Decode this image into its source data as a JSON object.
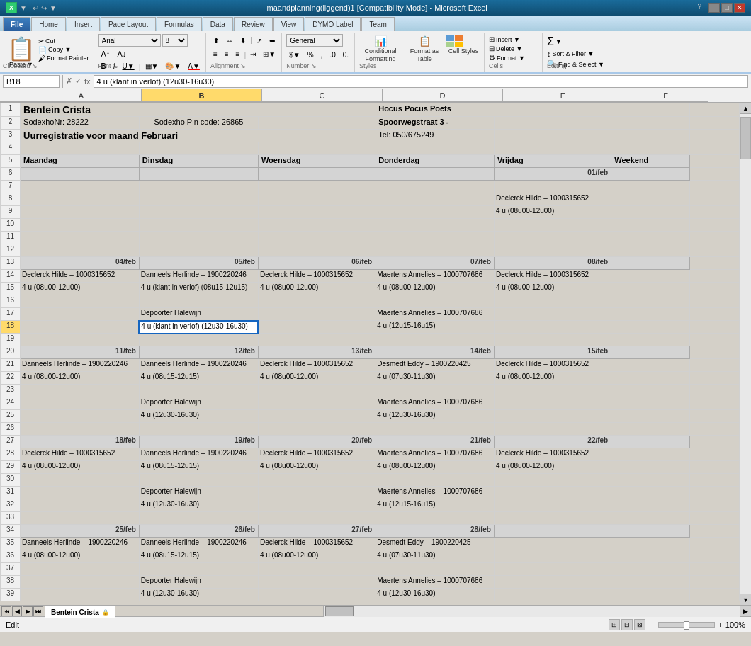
{
  "titleBar": {
    "title": "maandplanning(liggend)1 [Compatibility Mode] - Microsoft Excel",
    "icon": "X",
    "buttons": [
      "─",
      "□",
      "✕"
    ]
  },
  "tabs": [
    {
      "label": "File",
      "type": "file"
    },
    {
      "label": "Home",
      "sub": "H"
    },
    {
      "label": "Insert",
      "sub": "N"
    },
    {
      "label": "Page Layout",
      "sub": "P"
    },
    {
      "label": "Formulas",
      "sub": "M"
    },
    {
      "label": "Data",
      "sub": "A"
    },
    {
      "label": "Review",
      "sub": "R"
    },
    {
      "label": "View",
      "sub": "W"
    },
    {
      "label": "DYMO Label",
      "sub": "Y1"
    },
    {
      "label": "Team",
      "sub": "Y2"
    }
  ],
  "ribbon": {
    "font": "Arial",
    "size": "8",
    "groups": {
      "clipboard": "Clipboard",
      "font": "Font",
      "alignment": "Alignment",
      "number": "Number",
      "styles": "Styles",
      "cells": "Cells",
      "editing": "Editing"
    },
    "conditionalFormatting": "Conditional Formatting",
    "formatAsTable": "Format as Table",
    "cellStyles": "Cell Styles",
    "format": "Format ▼"
  },
  "formulaBar": {
    "nameBox": "B18",
    "formula": "4 u (klant in verlof) (12u30-16u30)"
  },
  "columns": [
    "A",
    "B",
    "C",
    "D",
    "E",
    "F"
  ],
  "spreadsheet": {
    "title1": "Bentein Crista",
    "title2_left": "SodexhoNr: 28222",
    "title2_middle": "Sodexho Pin code: 26865",
    "title2_right": "Hocus Pocus Poets",
    "title3": "Uurregistratie voor maand Februari",
    "title2_addr": "Spoorwegstraat 3 -",
    "title2_tel": "Tel: 050/675249",
    "days": [
      "Maandag",
      "Dinsdag",
      "Woensdag",
      "Donderdag",
      "Vrijdag",
      "Weekend"
    ],
    "weeks": [
      {
        "row": 6,
        "dates": [
          "",
          "",
          "",
          "",
          "01/feb",
          ""
        ],
        "rows": [
          {
            "row": 7,
            "cells": [
              "",
              "",
              "",
              "",
              "",
              ""
            ]
          },
          {
            "row": 8,
            "cells": [
              "",
              "",
              "",
              "",
              "Declerck Hilde – 1000315652",
              ""
            ]
          },
          {
            "row": 9,
            "cells": [
              "",
              "",
              "",
              "",
              "4 u (08u00-12u00)",
              ""
            ]
          },
          {
            "row": 10,
            "cells": [
              "",
              "",
              "",
              "",
              "",
              ""
            ]
          },
          {
            "row": 11,
            "cells": [
              "",
              "",
              "",
              "",
              "",
              ""
            ]
          },
          {
            "row": 12,
            "cells": [
              "",
              "",
              "",
              "",
              "",
              ""
            ]
          }
        ]
      },
      {
        "row": 13,
        "dates": [
          "04/feb",
          "05/feb",
          "06/feb",
          "07/feb",
          "08/feb",
          ""
        ],
        "rows": [
          {
            "row": 14,
            "cells": [
              "Declerck Hilde – 1000315652",
              "Danneels Herlinde – 1900220246",
              "Declerck Hilde – 1000315652",
              "Maertens Annelies – 1000707686",
              "Declerck Hilde – 1000315652",
              ""
            ]
          },
          {
            "row": 15,
            "cells": [
              "4 u (08u00-12u00)",
              "4 u (klant in verlof) (08u15-12u15)",
              "4 u (08u00-12u00)",
              "4 u (08u00-12u00)",
              "4 u (08u00-12u00)",
              ""
            ]
          },
          {
            "row": 16,
            "cells": [
              "",
              "",
              "",
              "",
              "",
              ""
            ]
          },
          {
            "row": 17,
            "cells": [
              "",
              "Depoorter Halewijn",
              "",
              "Maertens Annelies – 1000707686",
              "",
              ""
            ]
          },
          {
            "row": 18,
            "cells": [
              "",
              "4 u (klant in verlof) (12u30-16u30)",
              "",
              "4 u (12u15-16u15)",
              "",
              ""
            ]
          },
          {
            "row": 19,
            "cells": [
              "",
              "",
              "",
              "",
              "",
              ""
            ]
          }
        ]
      },
      {
        "row": 20,
        "dates": [
          "11/feb",
          "12/feb",
          "13/feb",
          "14/feb",
          "15/feb",
          ""
        ],
        "rows": [
          {
            "row": 21,
            "cells": [
              "Danneels Herlinde – 1900220246",
              "Danneels Herlinde – 1900220246",
              "Declerck Hilde – 1000315652",
              "Desmedt Eddy – 1900220425",
              "Declerck Hilde – 1000315652",
              ""
            ]
          },
          {
            "row": 22,
            "cells": [
              "4 u (08u00-12u00)",
              "4 u (08u15-12u15)",
              "4 u (08u00-12u00)",
              "4 u (07u30-11u30)",
              "4 u (08u00-12u00)",
              ""
            ]
          },
          {
            "row": 23,
            "cells": [
              "",
              "",
              "",
              "",
              "",
              ""
            ]
          },
          {
            "row": 24,
            "cells": [
              "",
              "Depoorter Halewijn",
              "",
              "Maertens Annelies – 1000707686",
              "",
              ""
            ]
          },
          {
            "row": 25,
            "cells": [
              "",
              "4 u (12u30-16u30)",
              "",
              "4 u (12u30-16u30)",
              "",
              ""
            ]
          },
          {
            "row": 26,
            "cells": [
              "",
              "",
              "",
              "",
              "",
              ""
            ]
          }
        ]
      },
      {
        "row": 27,
        "dates": [
          "18/feb",
          "19/feb",
          "20/feb",
          "21/feb",
          "22/feb",
          ""
        ],
        "rows": [
          {
            "row": 28,
            "cells": [
              "Declerck Hilde – 1000315652",
              "Danneels Herlinde – 1900220246",
              "Declerck Hilde – 1000315652",
              "Maertens Annelies – 1000707686",
              "Declerck Hilde – 1000315652",
              ""
            ]
          },
          {
            "row": 29,
            "cells": [
              "4 u (08u00-12u00)",
              "4 u (08u15-12u15)",
              "4 u (08u00-12u00)",
              "4 u (08u00-12u00)",
              "4 u (08u00-12u00)",
              ""
            ]
          },
          {
            "row": 30,
            "cells": [
              "",
              "",
              "",
              "",
              "",
              ""
            ]
          },
          {
            "row": 31,
            "cells": [
              "",
              "Depoorter Halewijn",
              "",
              "Maertens Annelies – 1000707686",
              "",
              ""
            ]
          },
          {
            "row": 32,
            "cells": [
              "",
              "4 u (12u30-16u30)",
              "",
              "4 u (12u15-16u15)",
              "",
              ""
            ]
          },
          {
            "row": 33,
            "cells": [
              "",
              "",
              "",
              "",
              "",
              ""
            ]
          }
        ]
      },
      {
        "row": 34,
        "dates": [
          "25/feb",
          "26/feb",
          "27/feb",
          "28/feb",
          "",
          ""
        ],
        "rows": [
          {
            "row": 35,
            "cells": [
              "Danneels Herlinde – 1900220246",
              "Danneels Herlinde – 1900220246",
              "Declerck Hilde – 1000315652",
              "Desmedt Eddy – 1900220425",
              "",
              ""
            ]
          },
          {
            "row": 36,
            "cells": [
              "4 u (08u00-12u00)",
              "4 u (08u15-12u15)",
              "4 u (08u00-12u00)",
              "4 u (07u30-11u30)",
              "",
              ""
            ]
          },
          {
            "row": 37,
            "cells": [
              "",
              "",
              "",
              "",
              "",
              ""
            ]
          },
          {
            "row": 38,
            "cells": [
              "",
              "Depoorter Halewijn",
              "",
              "Maertens Annelies – 1000707686",
              "",
              ""
            ]
          },
          {
            "row": 39,
            "cells": [
              "",
              "4 u (12u30-16u30)",
              "",
              "4 u (12u30-16u30)",
              "",
              ""
            ]
          }
        ]
      }
    ]
  },
  "sheetTabs": [
    "Bentein Crista"
  ],
  "statusBar": {
    "left": "Edit",
    "right": "100%"
  }
}
